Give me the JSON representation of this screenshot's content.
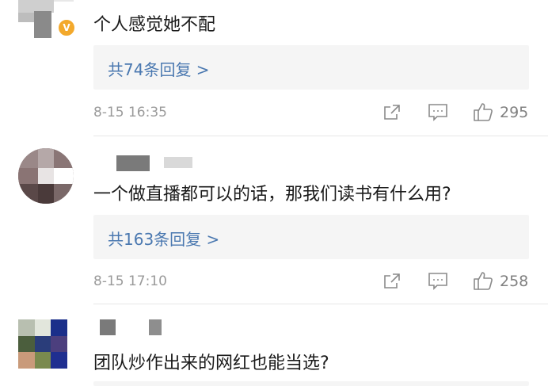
{
  "comments": [
    {
      "text": "个人感觉她不配",
      "reply_link": "共74条回复 >",
      "time": "8-15 16:35",
      "likes": "295",
      "verified_badge": "V"
    },
    {
      "text": "一个做直播都可以的话，那我们读书有什么用?",
      "reply_link": "共163条回复 >",
      "time": "8-15 17:10",
      "likes": "258"
    },
    {
      "text": "团队炒作出来的网红也能当选?"
    }
  ],
  "icons": {
    "share": "share-icon",
    "comment": "comment-icon",
    "like": "thumbs-up-icon"
  },
  "colors": {
    "link": "#4a78b0",
    "meta": "#9a9a9a",
    "reply_bg": "#f5f5f5",
    "badge": "#f3a92c"
  }
}
